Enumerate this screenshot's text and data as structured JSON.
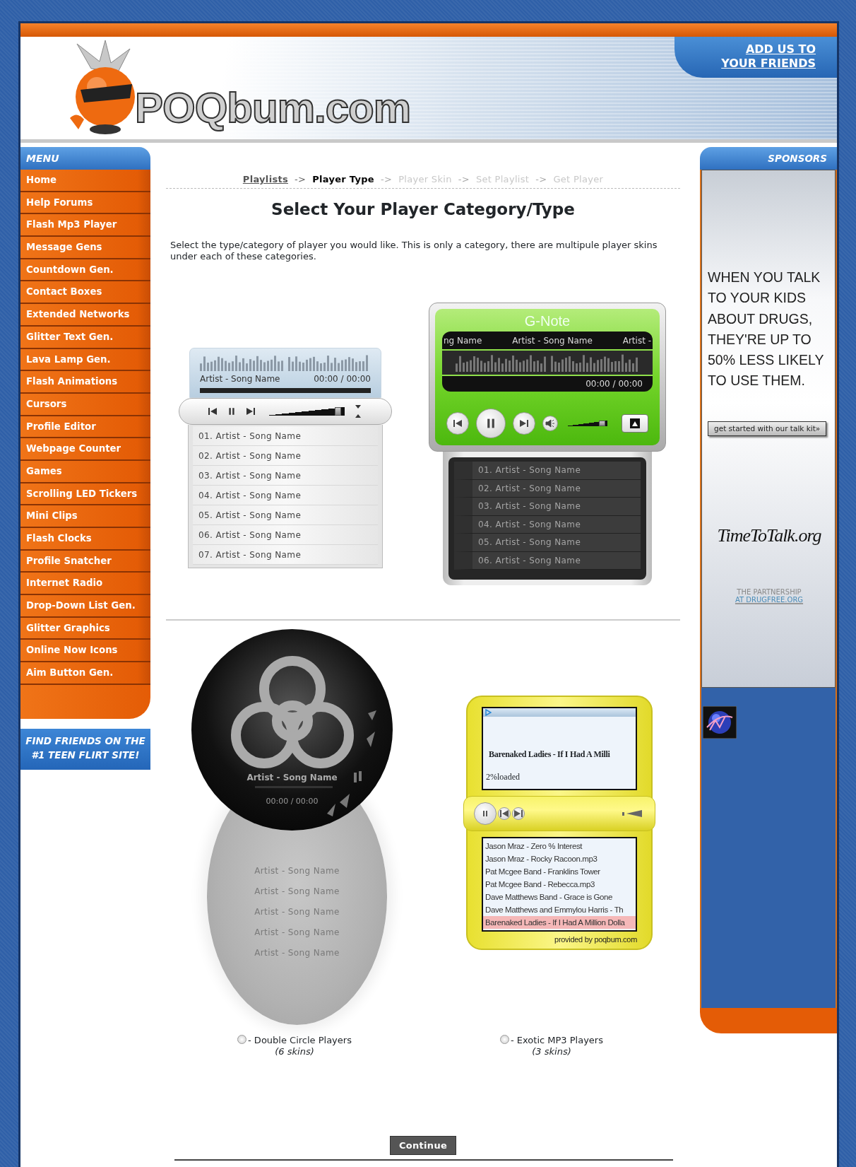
{
  "header": {
    "logo": "POQbum.com",
    "add_us": "ADD US TO YOUR FRIENDS"
  },
  "menu": {
    "title": "MENU",
    "items": [
      "Home",
      "Help Forums",
      "Flash Mp3 Player",
      "Message Gens",
      "Countdown Gen.",
      "Contact Boxes",
      "Extended Networks",
      "Glitter Text Gen.",
      "Lava Lamp Gen.",
      "Flash Animations",
      "Cursors",
      "Profile Editor",
      "Webpage Counter",
      "Games",
      "Scrolling LED Tickers",
      "Mini Clips",
      "Flash Clocks",
      "Profile Snatcher",
      "Internet Radio",
      "Drop-Down List Gen.",
      "Glitter Graphics",
      "Online Now Icons",
      "Aim Button Gen."
    ]
  },
  "promo": "FIND FRIENDS ON THE #1 TEEN FLIRT SITE!",
  "steps": [
    {
      "label": "Playlists",
      "completed": true,
      "selected": false
    },
    {
      "label": "Player Type",
      "completed": false,
      "selected": true
    },
    {
      "label": "Player Skin",
      "completed": false,
      "selected": false
    },
    {
      "label": "Set Playlist",
      "completed": false,
      "selected": false
    },
    {
      "label": "Get Player",
      "completed": false,
      "selected": false
    }
  ],
  "step_separator": "->",
  "title": "Select Your Player Category/Type",
  "intro": "Select the type/category of player you would like. This is only a category, there are multipule player skins under each of these categories.",
  "players": [
    {
      "kind": "classic",
      "now_playing": "Artist - Song Name",
      "time": "00:00 / 00:00",
      "volume": {
        "level": 0.95
      },
      "tracks": [
        "01. Artist - Song Name",
        "02. Artist - Song Name",
        "03. Artist - Song Name",
        "04. Artist - Song Name",
        "05. Artist - Song Name",
        "06. Artist - Song Name",
        "07. Artist - Song Name"
      ]
    },
    {
      "kind": "gnote",
      "title": "G-Note",
      "ticker": [
        "ng Name",
        "Artist - Song Name",
        "Artist -"
      ],
      "time": "00:00 / 00:00",
      "volume": {
        "level": 0.95
      },
      "tracks": [
        "01. Artist - Song Name",
        "02. Artist - Song Name",
        "03. Artist - Song Name",
        "04. Artist - Song Name",
        "05. Artist - Song Name",
        "06. Artist - Song Name"
      ]
    },
    {
      "kind": "circle",
      "now_playing": "Artist - Song Name",
      "time": "00:00 / 00:00",
      "tracks": [
        "Artist - Song Name",
        "Artist - Song Name",
        "Artist - Song Name",
        "Artist - Song Name",
        "Artist - Song Name"
      ]
    },
    {
      "kind": "exotic",
      "now_playing": "Barenaked Ladies - If I Had A Milli",
      "load_status": "2%loaded",
      "tracks": [
        {
          "label": "Jason Mraz - Zero % Interest",
          "selected": false
        },
        {
          "label": "Jason Mraz - Rocky Racoon.mp3",
          "selected": false
        },
        {
          "label": "Pat Mcgee Band - Franklins Tower",
          "selected": false
        },
        {
          "label": "Pat Mcgee Band - Rebecca.mp3",
          "selected": false
        },
        {
          "label": "Dave Matthews Band - Grace is Gone",
          "selected": false
        },
        {
          "label": "Dave Matthews and Emmylou Harris - Th",
          "selected": false
        },
        {
          "label": "Barenaked Ladies - If I Had A Million Dolla",
          "selected": true
        }
      ],
      "credit": "provided by poqbum.com"
    }
  ],
  "categories": [
    {
      "label": "- Double Circle Players",
      "skins": "(6 skins)",
      "selected": false
    },
    {
      "label": "- Exotic MP3 Players",
      "skins": "(3 skins)",
      "selected": false
    }
  ],
  "continue_button": "Continue",
  "sponsors": {
    "title": "SPONSORS",
    "headline": "WHEN YOU TALK TO YOUR KIDS ABOUT DRUGS, THEY'RE UP TO 50% LESS LIKELY TO USE THEM.",
    "button": "get started with our talk kit»",
    "brand": "TimeToTalk.org",
    "partner_top": "THE PARTNERSHIP",
    "partner_bottom": "AT DRUGFREE.ORG"
  }
}
